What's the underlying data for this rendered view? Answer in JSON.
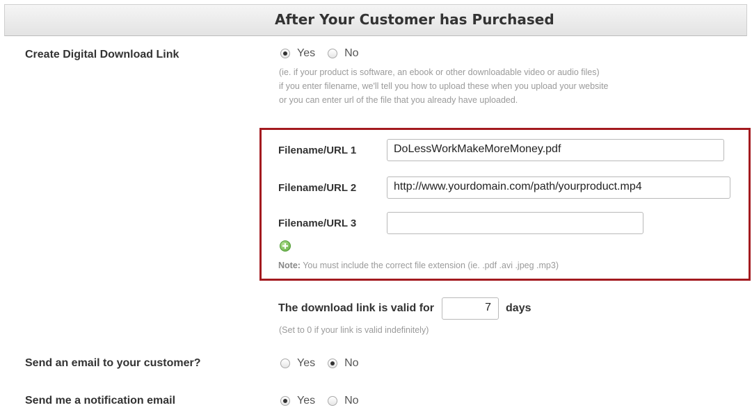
{
  "header": {
    "title": "After Your Customer has Purchased"
  },
  "digital_download": {
    "label": "Create Digital Download Link",
    "options": [
      {
        "label": "Yes",
        "checked": true
      },
      {
        "label": "No",
        "checked": false
      }
    ],
    "help_lines": [
      "(ie. if your product is software, an ebook or other downloadable video or audio files)",
      "if you enter filename, we'll tell you how to upload these when you upload your website",
      "or you can enter url of the file that you already have uploaded."
    ]
  },
  "files": [
    {
      "label": "Filename/URL 1",
      "value": "DoLessWorkMakeMoreMoney.pdf"
    },
    {
      "label": "Filename/URL 2",
      "value": "http://www.yourdomain.com/path/yourproduct.mp4"
    },
    {
      "label": "Filename/URL 3",
      "value": ""
    }
  ],
  "add_icon": "plus-circle-icon",
  "note": {
    "bold": "Note:",
    "text": "You must include the correct file extension (ie. .pdf .avi .jpeg .mp3)"
  },
  "validity": {
    "label": "The download link is valid for",
    "value": "7",
    "unit": "days",
    "help": "(Set to 0 if your link is valid indefinitely)"
  },
  "email_customer": {
    "label": "Send an email to your customer?",
    "options": [
      {
        "label": "Yes",
        "checked": false
      },
      {
        "label": "No",
        "checked": true
      }
    ]
  },
  "notification": {
    "label": "Send me a notification email",
    "options": [
      {
        "label": "Yes",
        "checked": true
      },
      {
        "label": "No",
        "checked": false
      }
    ]
  },
  "colors": {
    "highlight_border": "#a31a1f",
    "add_icon_green": "#5aa83a"
  }
}
